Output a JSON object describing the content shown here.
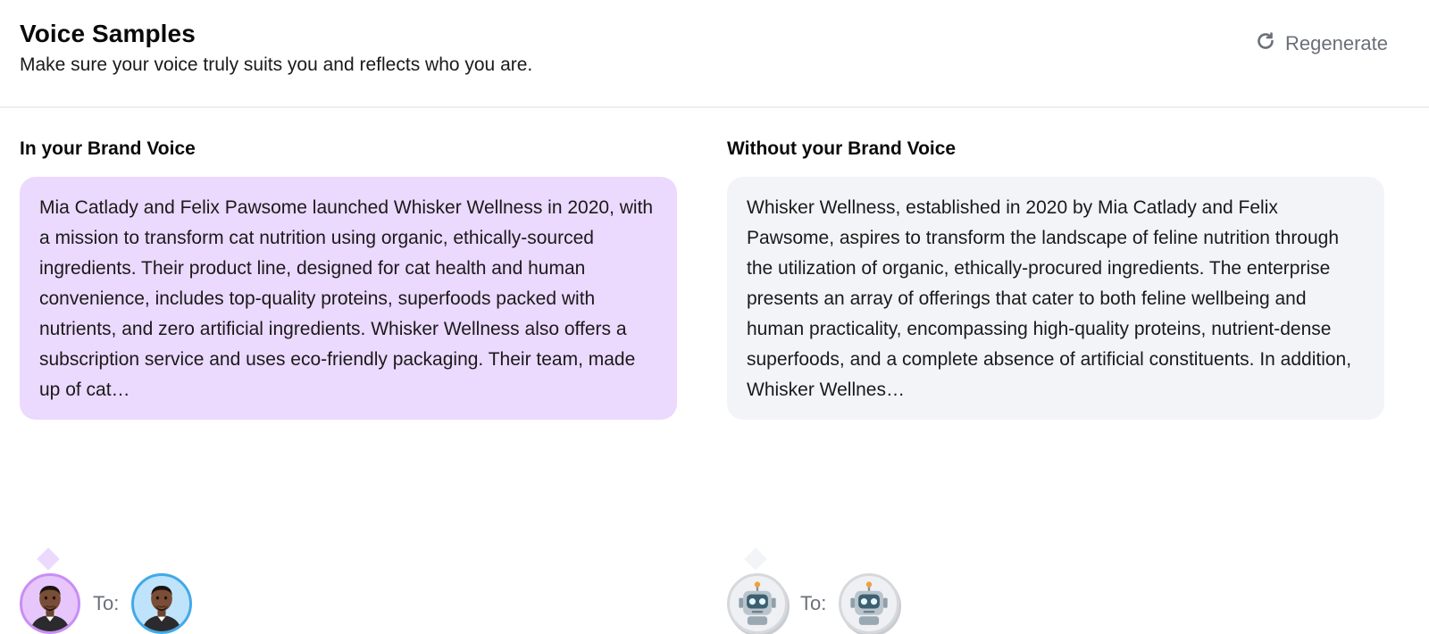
{
  "header": {
    "title": "Voice Samples",
    "subtitle": "Make sure your voice truly suits you and reflects who you are.",
    "regenerate_label": "Regenerate"
  },
  "left": {
    "title": "In your Brand Voice",
    "text": "Mia Catlady and Felix Pawsome launched Whisker Wellness in 2020, with a mission to transform cat nutrition using organic, ethically-sourced ingredients. Their product line, designed for cat health and human convenience, includes top-quality proteins, superfoods packed with nutrients, and zero artificial ingredients. Whisker Wellness also offers a subscription service and uses eco-friendly packaging. Their team, made up of cat…",
    "to_label": "To:",
    "from_avatar": "person-avatar",
    "to_avatar": "person-avatar"
  },
  "right": {
    "title": "Without your Brand Voice",
    "text": "Whisker Wellness, established in 2020 by Mia Catlady and Felix Pawsome, aspires to transform the landscape of feline nutrition through the utilization of organic, ethically-procured ingredients. The enterprise presents an array of offerings that cater to both feline wellbeing and human practicality, encompassing high-quality proteins, nutrient-dense superfoods, and a complete absence of artificial constituents. In addition, Whisker Wellnes…",
    "to_label": "To:",
    "from_avatar": "robot-avatar",
    "to_avatar": "robot-avatar"
  },
  "colors": {
    "brand_bubble": "#ecd9fe",
    "plain_bubble": "#f3f4f8",
    "muted_text": "#6b6f78",
    "avatar_purple_ring": "#c98ef5",
    "avatar_blue_ring": "#42a9e8"
  }
}
